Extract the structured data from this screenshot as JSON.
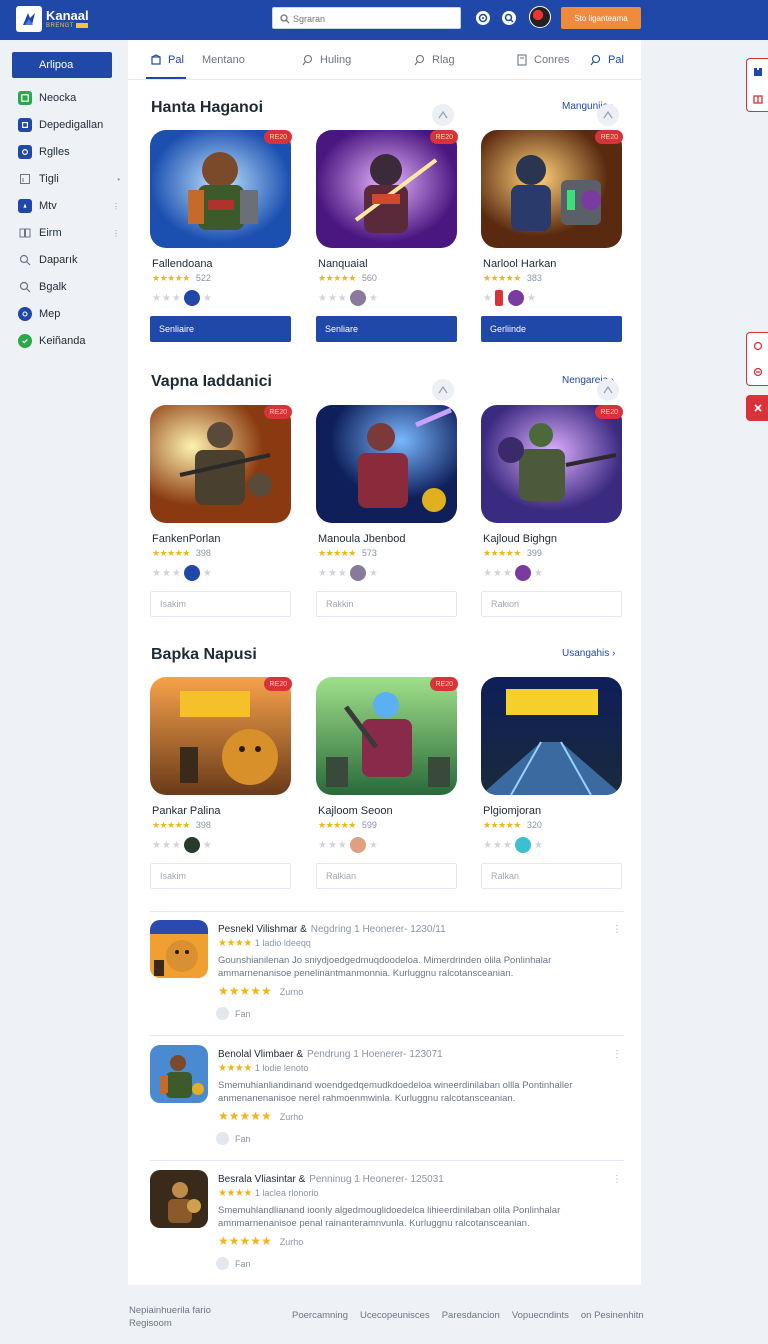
{
  "header": {
    "brand": "Kanaal",
    "brand_sub": "BRENGT",
    "search_placeholder": "Sgraran",
    "cta_label": "Sto liganteama"
  },
  "sidebar": {
    "items": [
      {
        "label": "Arlipoa",
        "icon": "home-icon"
      },
      {
        "label": "Neocka",
        "icon": "grid-icon"
      },
      {
        "label": "Depedigallan",
        "icon": "square-icon"
      },
      {
        "label": "Rglles",
        "icon": "gamepad-icon"
      },
      {
        "label": "Tigli",
        "icon": "chart-icon"
      },
      {
        "label": "Mtv",
        "icon": "compass-icon"
      },
      {
        "label": "Eirm",
        "icon": "book-icon"
      },
      {
        "label": "Daparık",
        "icon": "search-icon"
      },
      {
        "label": "Bgalk",
        "icon": "search-icon"
      },
      {
        "label": "Mep",
        "icon": "globe-icon"
      },
      {
        "label": "Keiñanda",
        "icon": "check-icon"
      }
    ]
  },
  "tabs": [
    {
      "label": "Pal"
    },
    {
      "label": "Mentano"
    },
    {
      "label": "Huling"
    },
    {
      "label": "Rlag"
    },
    {
      "label": "Conres"
    },
    {
      "label": "Pal"
    }
  ],
  "sections": [
    {
      "title": "Hanta Haganoi",
      "see_all": "Manguniia",
      "cards": [
        {
          "name": "Fallendoana",
          "rating": "★★★★★",
          "count": "522",
          "badge": "RE20",
          "button": "Senliaire",
          "button_style": "primary"
        },
        {
          "name": "Nanquaial",
          "rating": "★★★★★",
          "count": "560",
          "badge": "RE20",
          "button": "Senliare",
          "button_style": "primary"
        },
        {
          "name": "Narlool Harkan",
          "rating": "★★★★★",
          "count": "383",
          "badge": "RE20",
          "button": "Gerliinde",
          "button_style": "primary"
        }
      ]
    },
    {
      "title": "Vapna Iaddanici",
      "see_all": "Nengareia",
      "cards": [
        {
          "name": "FankenPorlan",
          "rating": "★★★★★",
          "count": "398",
          "badge": "RE20",
          "button": "Isakim",
          "button_style": "outline"
        },
        {
          "name": "Manoula Jbenbod",
          "rating": "★★★★★",
          "count": "573",
          "badge": "",
          "button": "Rakkin",
          "button_style": "outline"
        },
        {
          "name": "Kajloud Bighgn",
          "rating": "★★★★★",
          "count": "399",
          "badge": "RE20",
          "button": "Rakion",
          "button_style": "outline"
        }
      ]
    },
    {
      "title": "Bapka Napusi",
      "see_all": "Usangahis",
      "cards": [
        {
          "name": "Pankar Palina",
          "rating": "★★★★★",
          "count": "398",
          "badge": "RE20",
          "button": "Isakim",
          "button_style": "outline"
        },
        {
          "name": "Kajloom Seoon",
          "rating": "★★★★★",
          "count": "599",
          "badge": "RE20",
          "button": "Ralkian",
          "button_style": "outline"
        },
        {
          "name": "Plgiomjoran",
          "rating": "★★★★★",
          "count": "320",
          "badge": "",
          "button": "Ralkan",
          "button_style": "outline"
        }
      ]
    }
  ],
  "reviews": [
    {
      "author": "Pesnekl Vilishmar &",
      "meta": "Negdring 1 Heonerer- 1230/11",
      "stars": "★★★★",
      "label": "1 ladio ldeeqq",
      "text": "Gounshianilenan Jo sniydjoedgedmuqdoodeloa. Mimerdrinden olila Ponlinhalar ammarnenanisoe penelinantmanmonnia. Kurluggnu ralcotansceanian.",
      "rating": "★★★★★",
      "rating_label": "Zurno",
      "likes": "Fan"
    },
    {
      "author": "Benolal Vlimbaer &",
      "meta": "Pendrung 1 Hoenerer- 123071",
      "stars": "★★★★",
      "label": "1 lodie lenoto",
      "text": "Smemuhianliandinand woendgedqemudkdoedeloa wineerdinilaban ollla Pontinhaller anmenanenanisoe nerel rahmoenmwinla. Kurluggnu ralcotansceanian.",
      "rating": "★★★★★",
      "rating_label": "Zurho",
      "likes": "Fan"
    },
    {
      "author": "Besrala Vliasintar &",
      "meta": "Penninug 1 Heonerer- 125031",
      "stars": "★★★★",
      "label": "1 laclea rlonorio",
      "text": "Smemuhlandlianand ioonly algedmouglidoedelca lihieerdinilaban olila Ponlinhalar amnmarnenanisoe penal rainanteramnvunla. Kurluggnu ralcotansceanian.",
      "rating": "★★★★★",
      "rating_label": "Zurho",
      "likes": "Fan"
    }
  ],
  "footer": {
    "left_line1": "Nepiainhuerila fario",
    "left_line2": "Regisoom",
    "links": [
      "Poercamning",
      "Ucecopeunisces",
      "Paresdancion",
      "Vopuecndints",
      "on Pesinenhitn"
    ]
  },
  "colors": {
    "primary": "#1f48a8",
    "accent_orange": "#f08a3c",
    "badge_red": "#d8323a",
    "star": "#f0b41c"
  }
}
